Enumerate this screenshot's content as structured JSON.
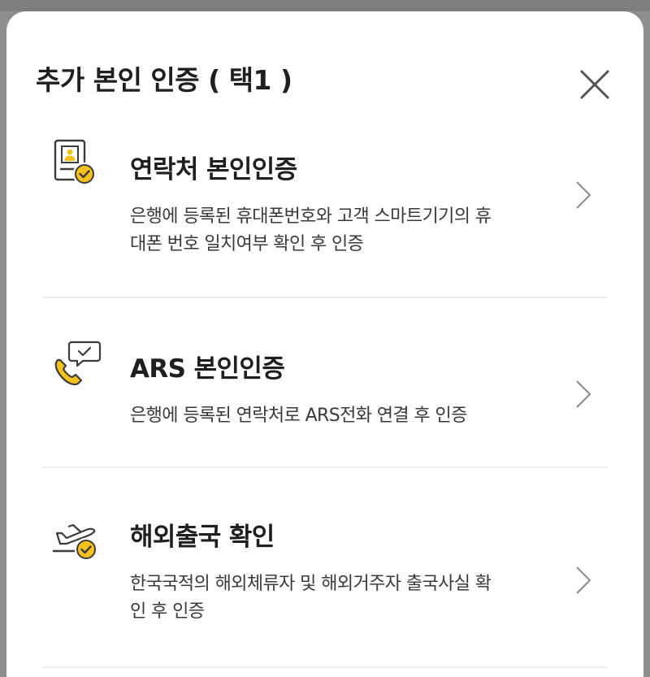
{
  "sheet": {
    "title": "추가 본인 인증 ( 택1 )",
    "close_label": "닫기"
  },
  "options": [
    {
      "title": "연락처 본인인증",
      "description_lines": [
        "은행에 등록된 휴대폰번호와 고객 스마트기기의 휴",
        "대폰 번호 일치여부 확인 후 인증"
      ],
      "icon": "contact-verification-icon"
    },
    {
      "title": "ARS 본인인증",
      "description_lines": [
        "은행에 등록된 연락처로 ARS전화 연결 후 인증"
      ],
      "icon": "ars-phone-icon"
    },
    {
      "title": "해외출국 확인",
      "description_lines": [
        "한국국적의 해외체류자 및 해외거주자 출국사실 확",
        "인 후 인증"
      ],
      "icon": "airplane-departure-icon"
    }
  ],
  "colors": {
    "accent": "#f5c21b",
    "icon_stroke": "#3c3c3c",
    "text": "#1f1f1f"
  }
}
